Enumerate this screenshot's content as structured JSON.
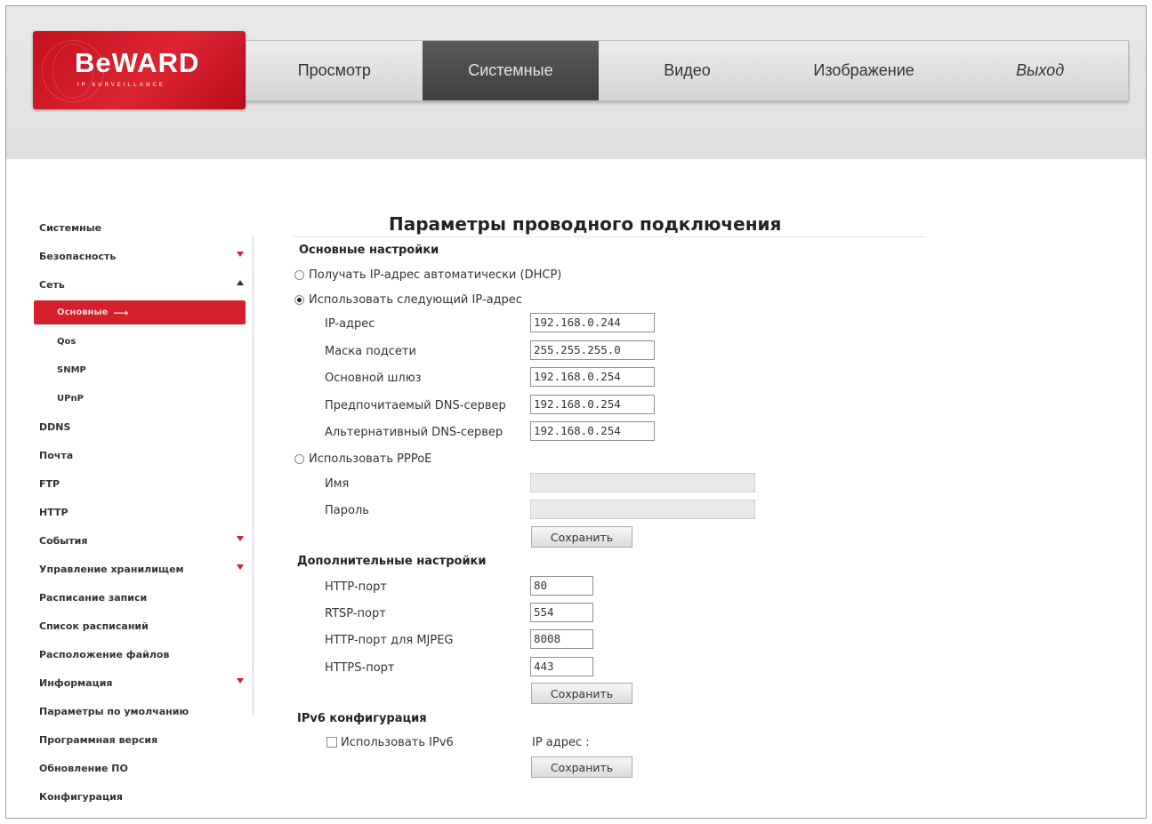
{
  "logo": {
    "brand": "BeWARD",
    "tagline": "IP SURVEILLANCE"
  },
  "nav": {
    "items": [
      {
        "label": "Просмотр",
        "active": false,
        "italic": false,
        "width": 198
      },
      {
        "label": "Системные",
        "active": true,
        "italic": false,
        "width": 199
      },
      {
        "label": "Видео",
        "active": false,
        "italic": false,
        "width": 199
      },
      {
        "label": "Изображение",
        "active": false,
        "italic": false,
        "width": 199
      },
      {
        "label": "Выход",
        "active": false,
        "italic": true,
        "width": 198
      }
    ]
  },
  "sidebar": {
    "items": [
      {
        "label": "Системные",
        "level": 0,
        "arrow": ""
      },
      {
        "label": "Безопасность",
        "level": 0,
        "arrow": "down"
      },
      {
        "label": "Сеть",
        "level": 0,
        "arrow": "up"
      },
      {
        "label": "Основные",
        "level": 1,
        "arrow": "",
        "selected": true
      },
      {
        "label": "Qos",
        "level": 1,
        "arrow": ""
      },
      {
        "label": "SNMP",
        "level": 1,
        "arrow": ""
      },
      {
        "label": "UPnP",
        "level": 1,
        "arrow": ""
      },
      {
        "label": "DDNS",
        "level": 0,
        "arrow": ""
      },
      {
        "label": "Почта",
        "level": 0,
        "arrow": ""
      },
      {
        "label": "FTP",
        "level": 0,
        "arrow": ""
      },
      {
        "label": "HTTP",
        "level": 0,
        "arrow": ""
      },
      {
        "label": "События",
        "level": 0,
        "arrow": "down"
      },
      {
        "label": "Управление хранилищем",
        "level": 0,
        "arrow": "down"
      },
      {
        "label": "Расписание записи",
        "level": 0,
        "arrow": ""
      },
      {
        "label": "Список расписаний",
        "level": 0,
        "arrow": ""
      },
      {
        "label": "Расположение файлов",
        "level": 0,
        "arrow": ""
      },
      {
        "label": "Информация",
        "level": 0,
        "arrow": "down"
      },
      {
        "label": "Параметры по умолчанию",
        "level": 0,
        "arrow": ""
      },
      {
        "label": "Программная версия",
        "level": 0,
        "arrow": ""
      },
      {
        "label": "Обновление ПО",
        "level": 0,
        "arrow": ""
      },
      {
        "label": "Конфигурация",
        "level": 0,
        "arrow": ""
      }
    ]
  },
  "main": {
    "title": "Параметры проводного подключения",
    "basic": {
      "heading": "Основные настройки",
      "dhcp_label": "Получать IP-адрес автоматически (DHCP)",
      "dhcp_checked": false,
      "static_label": "Использовать следующий IP-адрес",
      "static_checked": true,
      "ip_label": "IP-адрес",
      "ip_value": "192.168.0.244",
      "mask_label": "Маска подсети",
      "mask_value": "255.255.255.0",
      "gateway_label": "Основной шлюз",
      "gateway_value": "192.168.0.254",
      "dns1_label": "Предпочитаемый DNS-сервер",
      "dns1_value": "192.168.0.254",
      "dns2_label": "Альтернативный DNS-сервер",
      "dns2_value": "192.168.0.254",
      "pppoe_label": "Использовать PPPoE",
      "pppoe_checked": false,
      "name_label": "Имя",
      "name_value": "",
      "password_label": "Пароль",
      "password_value": "",
      "save_label": "Сохранить"
    },
    "advanced": {
      "heading": "Дополнительные настройки",
      "http_label": "HTTP-порт",
      "http_value": "80",
      "rtsp_label": "RTSP-порт",
      "rtsp_value": "554",
      "mjpeg_label": "HTTP-порт для MJPEG",
      "mjpeg_value": "8008",
      "https_label": "HTTPS-порт",
      "https_value": "443",
      "save_label": "Сохранить"
    },
    "ipv6": {
      "heading": "IPv6 конфигурация",
      "use_label": "Использовать IPv6",
      "use_checked": false,
      "address_label": "IP адрес :",
      "save_label": "Сохранить"
    }
  },
  "colors": {
    "accent": "#d41f2c",
    "nav_active": "#4a4a4a",
    "header_bg": "#e5e5e5"
  }
}
